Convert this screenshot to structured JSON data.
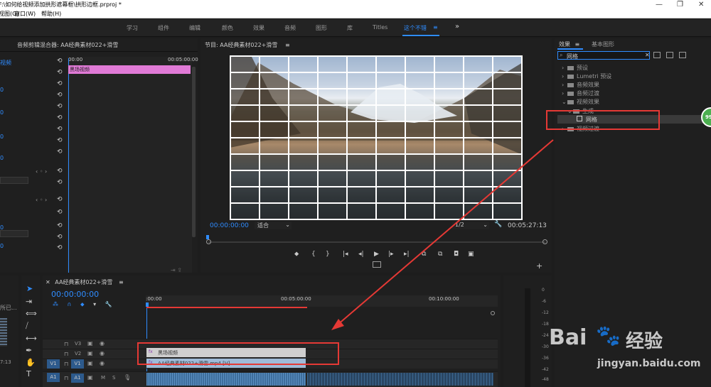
{
  "window": {
    "title": "F:\\如何给视频添加拱形遮幕框\\拱形边框.prproj *",
    "controls": [
      "—",
      "❐",
      "✕"
    ]
  },
  "menu": [
    "视图(G)",
    "窗口(W)",
    "帮助(H)"
  ],
  "workspaces": {
    "items": [
      "学习",
      "组件",
      "编辑",
      "颜色",
      "效果",
      "音频",
      "图形",
      "库",
      "Titles",
      "这个不错"
    ],
    "active": "这个不错",
    "menu_icon": "≡",
    "overflow": "»"
  },
  "source_panel": {
    "title": "音频剪辑混合器: AA经典素材022+滑雪",
    "mini_ruler_start": "00:00",
    "mini_ruler_end": "00:05:00:00",
    "clip_label": "黑场视频",
    "row_values": [
      "视频",
      "0",
      "0",
      "0",
      "0",
      "0",
      "0"
    ]
  },
  "program_monitor": {
    "title": "节目: AA经典素材022+滑雪",
    "menu_icon": "≡",
    "timecode": "00:00:00:00",
    "fit": "适合",
    "resolution": "1/2",
    "duration": "00:05:27:13",
    "wrench_icon": "🔧"
  },
  "effects_panel": {
    "tab_effects": "效果",
    "tab_menu": "≡",
    "tab_graphics": "基本图形",
    "search_value": "网格",
    "clear_icon": "✕",
    "tree": [
      {
        "label": "预设",
        "level": 0,
        "expanded": false
      },
      {
        "label": "Lumetri 预设",
        "level": 0,
        "expanded": false
      },
      {
        "label": "音频效果",
        "level": 0,
        "expanded": false
      },
      {
        "label": "音频过渡",
        "level": 0,
        "expanded": false
      },
      {
        "label": "视频效果",
        "level": 0,
        "expanded": true
      },
      {
        "label": "生成",
        "level": 1,
        "expanded": true
      },
      {
        "label": "网格",
        "level": 2,
        "expanded": false,
        "selected": true
      },
      {
        "label": "视频过渡",
        "level": 0,
        "expanded": false
      }
    ],
    "badge": "99"
  },
  "timeline": {
    "title": "AA经典素材022+滑雪",
    "menu_icon": "≡",
    "timecode": "00:00:00:00",
    "ruler_labels": [
      ":00:00",
      "00:05:00:00",
      "00:10:00:00"
    ],
    "tracks": [
      {
        "name": "V3",
        "type": "video"
      },
      {
        "name": "V2",
        "type": "video"
      },
      {
        "name": "V1",
        "type": "video",
        "target": "V1"
      },
      {
        "name": "A1",
        "type": "audio",
        "target": "A1",
        "m": "M",
        "s": "S"
      }
    ],
    "clips": [
      {
        "track": "V2",
        "label": "黑场视频",
        "fx": "fx"
      },
      {
        "track": "V1",
        "label": "AA经典素材022+滑雪.mp4 [V]",
        "fx": "fx"
      }
    ]
  },
  "left_panel": {
    "text": "所已...",
    "time": "7:13"
  },
  "audio_meter": {
    "labels": [
      "0",
      "-6",
      "-12",
      "-18",
      "-24",
      "-30",
      "-36",
      "-42",
      "-48",
      "-54"
    ]
  },
  "watermark": {
    "brand": "Bai",
    "paw": "🐾",
    "suffix": "经验",
    "url": "jingyan.baidu.com"
  },
  "colors": {
    "accent": "#2f8cff",
    "clip_pink": "#e07ad6",
    "video_clip": "#9fbbd8",
    "annotation_red": "#e53935",
    "badge_green": "#4caf50"
  }
}
